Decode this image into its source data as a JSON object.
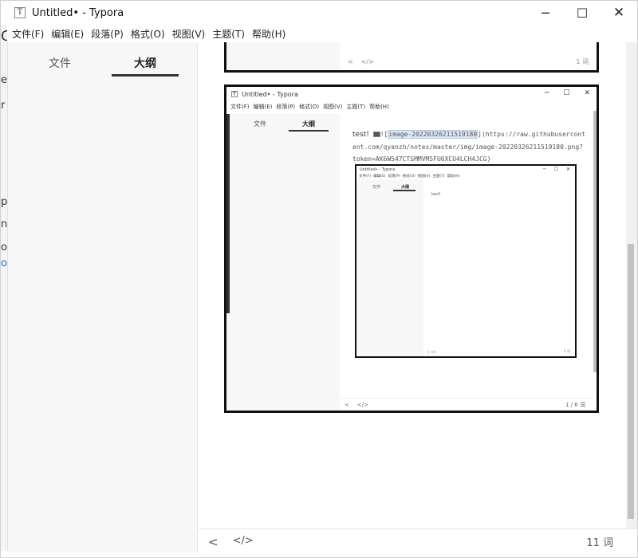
{
  "window": {
    "title": "Untitled• - Typora",
    "app_icon": "T",
    "controls": {
      "minimize": "─",
      "maximize": "☐",
      "close": "✕"
    }
  },
  "menu": [
    {
      "label": "文件(F)"
    },
    {
      "label": "编辑(E)"
    },
    {
      "label": "段落(P)"
    },
    {
      "label": "格式(O)"
    },
    {
      "label": "视图(V)"
    },
    {
      "label": "主题(T)"
    },
    {
      "label": "帮助(H)"
    }
  ],
  "sidebar": {
    "tabs": [
      {
        "label": "文件",
        "active": false
      },
      {
        "label": "大纲",
        "active": true
      }
    ]
  },
  "statusbar": {
    "left_arrow": "<",
    "source_toggle": "</>",
    "word_count": "11 词"
  },
  "embedded_top": {
    "left_arrow": "<",
    "source_toggle": "</>",
    "word_count": "1 词"
  },
  "embedded": {
    "title": "Untitled• - Typora",
    "app_icon": "T",
    "controls": {
      "minimize": "─",
      "maximize": "☐",
      "close": "✕"
    },
    "menu": [
      "文件(F)",
      "编辑(E)",
      "段落(P)",
      "格式(O)",
      "视图(V)",
      "主题(T)",
      "帮助(H)"
    ],
    "tabs": {
      "files": "文件",
      "outline": "大纲"
    },
    "content": {
      "test": "test!",
      "prefix": "![",
      "alt": "image-20220326211519180",
      "rest": "](https://raw.githubusercontent.com/qyanzh/notes/master/img/image-20220326211519180.png?token=AK6W547CTSMMVM5FU6XCU4LCH4JCG)"
    },
    "status": {
      "left_arrow": "<",
      "source_toggle": "</>",
      "word_count": "1 / 6 词"
    }
  },
  "nested": {
    "title": "Untitled• - Typora",
    "controls": {
      "minimize": "─",
      "maximize": "☐",
      "close": "✕"
    },
    "menu": [
      "文件(F)",
      "编辑(E)",
      "段落(P)",
      "格式(O)",
      "视图(V)",
      "主题(T)",
      "帮助(H)"
    ],
    "tabs": {
      "files": "文件",
      "outline": "大纲"
    },
    "test": "test!",
    "status": {
      "left": "< </>",
      "right": "1 词"
    }
  },
  "background_strip": [
    "G",
    "e",
    "r",
    "p",
    "n",
    "o",
    "o"
  ]
}
